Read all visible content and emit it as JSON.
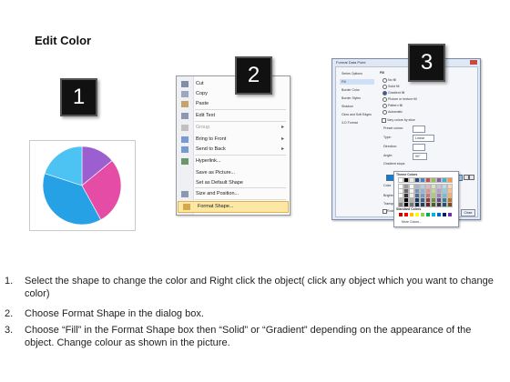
{
  "title": "Edit Color",
  "tiles": [
    "1",
    "2",
    "3"
  ],
  "pie": {
    "slices": [
      {
        "color": "#9b5fcf",
        "value": 14
      },
      {
        "color": "#e54ca6",
        "value": 28
      },
      {
        "color": "#27a1e6",
        "value": 38
      },
      {
        "color": "#4cc3f2",
        "value": 20
      }
    ]
  },
  "context_menu": {
    "items": [
      {
        "label": "Cut",
        "icon": "scissors-icon",
        "state": "normal",
        "submenu": false
      },
      {
        "label": "Copy",
        "icon": "copy-icon",
        "state": "normal",
        "submenu": false
      },
      {
        "label": "Paste",
        "icon": "paste-icon",
        "state": "normal",
        "submenu": false
      },
      {
        "label": "Edit Text",
        "icon": "edit-text-icon",
        "state": "normal",
        "submenu": false
      },
      {
        "label": "Group",
        "icon": "group-icon",
        "state": "disabled",
        "submenu": true
      },
      {
        "label": "Bring to Front",
        "icon": "bring-front-icon",
        "state": "normal",
        "submenu": true
      },
      {
        "label": "Send to Back",
        "icon": "send-back-icon",
        "state": "normal",
        "submenu": true
      },
      {
        "label": "Hyperlink...",
        "icon": "hyperlink-icon",
        "state": "normal",
        "submenu": false
      },
      {
        "label": "Save as Picture...",
        "icon": "",
        "state": "normal",
        "submenu": false
      },
      {
        "label": "Set as Default Shape",
        "icon": "",
        "state": "normal",
        "submenu": false
      },
      {
        "label": "Size and Position...",
        "icon": "size-position-icon",
        "state": "normal",
        "submenu": false
      },
      {
        "label": "Format Shape...",
        "icon": "format-shape-icon",
        "state": "highlighted",
        "submenu": false
      }
    ]
  },
  "dialog": {
    "caption": "Format Data Point",
    "categories": [
      "Series Options",
      "Fill",
      "Border Color",
      "Border Styles",
      "Shadow",
      "Glow and Soft Edges",
      "3-D Format"
    ],
    "selected_category": "Fill",
    "section": "Fill",
    "fill_options": [
      "No fill",
      "Solid fill",
      "Gradient fill",
      "Picture or texture fill",
      "Pattern fill",
      "Automatic"
    ],
    "selected_fill": "Gradient fill",
    "vary_colors": "Vary colors by slice",
    "fields": {
      "preset": "Preset colors:",
      "type": "Type:",
      "type_value": "Linear",
      "direction": "Direction:",
      "angle": "Angle:",
      "angle_value": "90°",
      "stops": "Gradient stops",
      "color": "Color",
      "position": "Position:",
      "position_value": "37%",
      "brightness": "Brightness:",
      "transparency": "Transparency:",
      "rotate": "Rotate with shape"
    },
    "close_label": "Close",
    "palette": {
      "theme_label": "Theme Colors",
      "standard_label": "Standard Colors",
      "more_label": "More Colors...",
      "theme_top": [
        "#ffffff",
        "#000000",
        "#eeece1",
        "#1f497d",
        "#4f81bd",
        "#c0504d",
        "#9bbb59",
        "#8064a2",
        "#4bacc6",
        "#f79646"
      ],
      "standard": [
        "#c00000",
        "#ff0000",
        "#ffc000",
        "#ffff00",
        "#92d050",
        "#00b050",
        "#00b0f0",
        "#0070c0",
        "#002060",
        "#7030a0"
      ]
    }
  },
  "steps": [
    {
      "n": "1.",
      "text": "Select the shape to change the color and Right click the object( click any object which you want to change color)"
    },
    {
      "n": "2.",
      "text": "Choose Format Shape in the dialog box."
    },
    {
      "n": "3.",
      "text": "Choose “Fill” in the Format Shape box then “Solid” or “Gradient” depending on the appearance of the object. Change colour as shown in the picture."
    }
  ]
}
